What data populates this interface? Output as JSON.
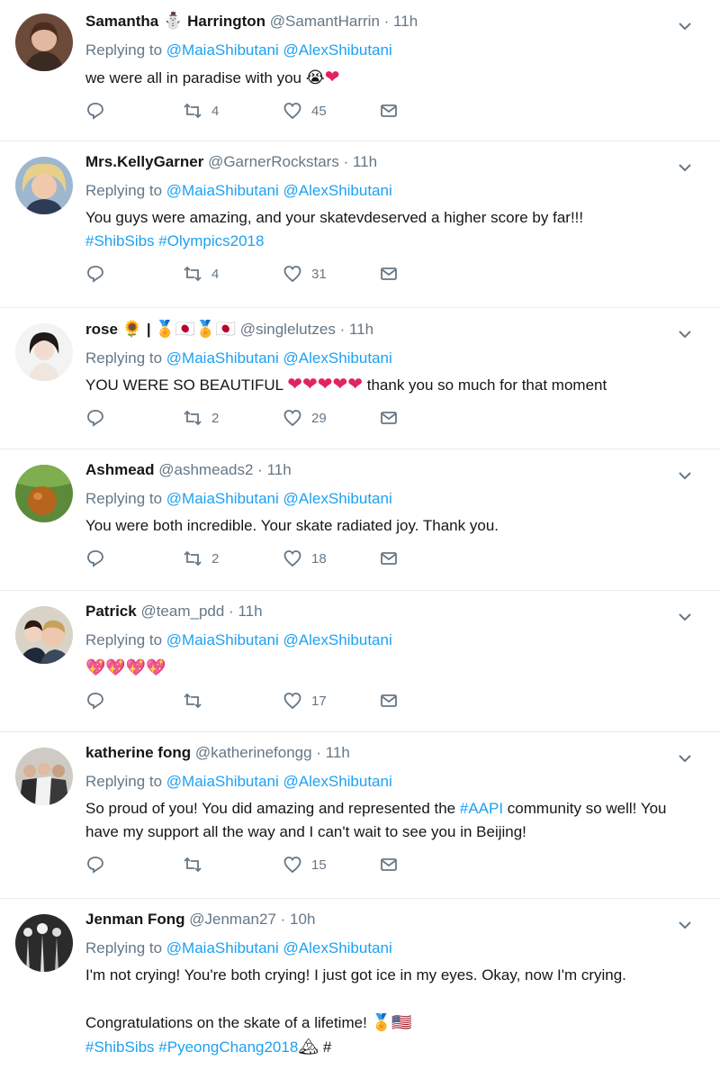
{
  "replying_label": "Replying to",
  "tweets": [
    {
      "name": "Samantha",
      "name_suffix": "Harrington",
      "handle": "@SamantHarrin",
      "sep": "·",
      "time": "11h",
      "mentions": [
        "@MaiaShibutani",
        "@AlexShibutani"
      ],
      "text": "we were all in paradise with you",
      "retweets": "4",
      "likes": "45"
    },
    {
      "name": "Mrs.KellyGarner",
      "handle": "@GarnerRockstars",
      "sep": "·",
      "time": "11h",
      "mentions": [
        "@MaiaShibutani",
        "@AlexShibutani"
      ],
      "text": "You guys were amazing, and your skatevdeserved a higher score by far!!!",
      "hashtags": "#ShibSibs #Olympics2018",
      "retweets": "4",
      "likes": "31"
    },
    {
      "name": "rose",
      "name_extra": "|",
      "handle": "@singlelutzes",
      "sep": "·",
      "time": "11h",
      "mentions": [
        "@MaiaShibutani",
        "@AlexShibutani"
      ],
      "text_a": "YOU WERE SO BEAUTIFUL",
      "text_b": "thank you so much for that moment",
      "retweets": "2",
      "likes": "29"
    },
    {
      "name": "Ashmead",
      "handle": "@ashmeads2",
      "sep": "·",
      "time": "11h",
      "mentions": [
        "@MaiaShibutani",
        "@AlexShibutani"
      ],
      "text": "You were both incredible. Your skate radiated joy. Thank you.",
      "retweets": "2",
      "likes": "18"
    },
    {
      "name": "Patrick",
      "handle": "@team_pdd",
      "sep": "·",
      "time": "11h",
      "mentions": [
        "@MaiaShibutani",
        "@AlexShibutani"
      ],
      "text": "💖💖💖💖",
      "retweets": "",
      "likes": "17"
    },
    {
      "name": "katherine fong",
      "handle": "@katherinefongg",
      "sep": "·",
      "time": "11h",
      "mentions": [
        "@MaiaShibutani",
        "@AlexShibutani"
      ],
      "text_a": "So proud of you! You did amazing and represented the ",
      "hashtag": "#AAPI",
      "text_b": " community so well! You have my support all the way and I can't wait to see you in Beijing!",
      "retweets": "",
      "likes": "15"
    },
    {
      "name": "Jenman Fong",
      "handle": "@Jenman27",
      "sep": "·",
      "time": "10h",
      "mentions": [
        "@MaiaShibutani",
        "@AlexShibutani"
      ],
      "text_a": "I'm not crying! You're both crying! I just got ice in my eyes. Okay, now I'm crying.",
      "text_b": "Congratulations on the skate of a lifetime!",
      "hashtags": "#ShibSibs #PyeongChang2018",
      "trailing": "#",
      "retweets": "",
      "likes": ""
    }
  ],
  "icons": {
    "reply": "reply-icon",
    "retweet": "retweet-icon",
    "like": "like-icon",
    "dm": "direct-message-icon",
    "more": "chevron-down-icon"
  },
  "colors": {
    "link": "#1da1f2",
    "muted": "#657786",
    "text": "#14171a",
    "divider": "#e6ecf0",
    "heart": "#e0245e"
  }
}
